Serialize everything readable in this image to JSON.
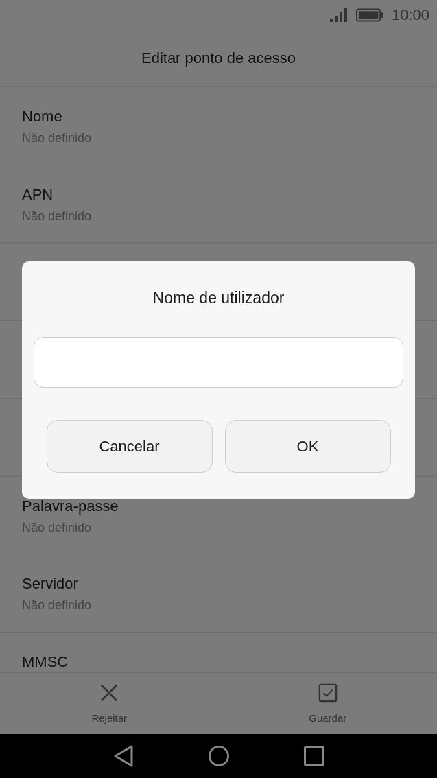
{
  "status_bar": {
    "time": "10:00"
  },
  "title": "Editar ponto de acesso",
  "settings_top": [
    {
      "title": "Nome",
      "value": "Não definido"
    },
    {
      "title": "APN",
      "value": "Não definido"
    }
  ],
  "settings_bottom": [
    {
      "title": "Palavra-passe",
      "value": "Não definido"
    },
    {
      "title": "Servidor",
      "value": "Não definido"
    },
    {
      "title": "MMSC"
    }
  ],
  "dialog": {
    "title": "Nome de utilizador",
    "buttons": [
      "Cancelar",
      "OK"
    ]
  },
  "bottom_bar": [
    {
      "kind": "close",
      "label": "Rejeitar"
    },
    {
      "kind": "check",
      "label": "Guardar"
    }
  ]
}
